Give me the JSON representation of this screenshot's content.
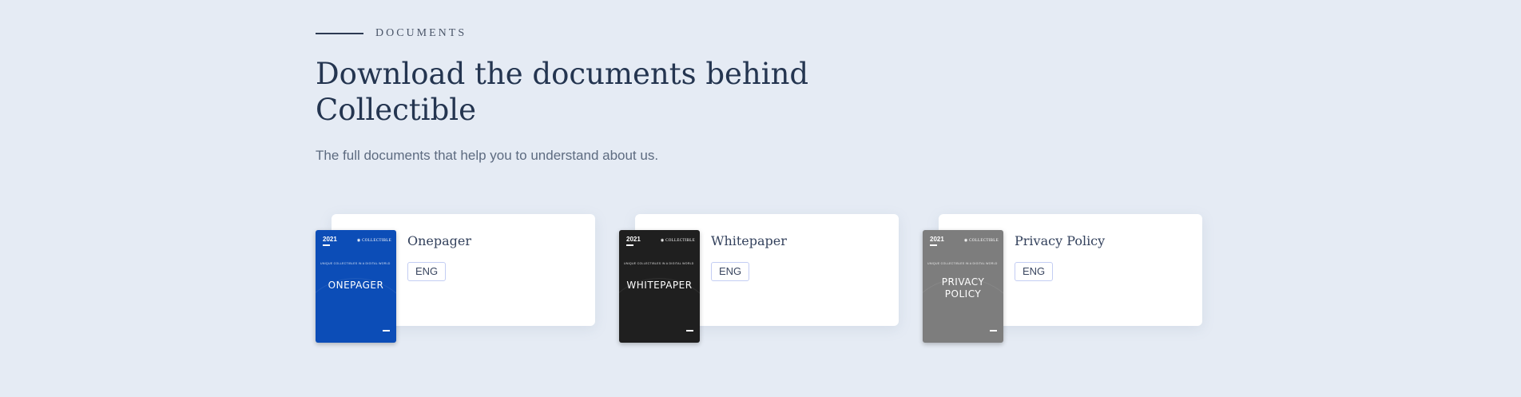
{
  "section": {
    "eyebrow": "DOCUMENTS",
    "title": "Download the documents behind Collectible",
    "subtitle": "The full documents that help you to understand about us."
  },
  "documents": [
    {
      "title": "Onepager",
      "language": "ENG",
      "cover": {
        "year": "2021",
        "brand": "COLLECTIBLE",
        "tagline": "UNIQUE COLLECTIBLES IN A DIGITAL WORLD",
        "name_line1": "ONEPAGER",
        "name_line2": "",
        "color": "#0c4db7"
      }
    },
    {
      "title": "Whitepaper",
      "language": "ENG",
      "cover": {
        "year": "2021",
        "brand": "COLLECTIBLE",
        "tagline": "UNIQUE COLLECTIBLES IN A DIGITAL WORLD",
        "name_line1": "WHITEPAPER",
        "name_line2": "",
        "color": "#1f1f1f"
      }
    },
    {
      "title": "Privacy Policy",
      "language": "ENG",
      "cover": {
        "year": "2021",
        "brand": "COLLECTIBLE",
        "tagline": "UNIQUE COLLECTIBLES IN A DIGITAL WORLD",
        "name_line1": "PRIVACY",
        "name_line2": "POLICY",
        "color": "#7d7d7d"
      }
    }
  ]
}
